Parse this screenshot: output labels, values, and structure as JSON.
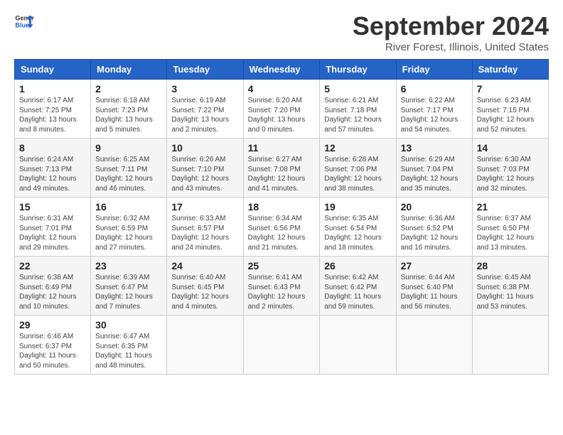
{
  "header": {
    "logo_line1": "General",
    "logo_line2": "Blue",
    "month": "September 2024",
    "location": "River Forest, Illinois, United States"
  },
  "days_of_week": [
    "Sunday",
    "Monday",
    "Tuesday",
    "Wednesday",
    "Thursday",
    "Friday",
    "Saturday"
  ],
  "weeks": [
    [
      {
        "day": "1",
        "info": "Sunrise: 6:17 AM\nSunset: 7:25 PM\nDaylight: 13 hours\nand 8 minutes."
      },
      {
        "day": "2",
        "info": "Sunrise: 6:18 AM\nSunset: 7:23 PM\nDaylight: 13 hours\nand 5 minutes."
      },
      {
        "day": "3",
        "info": "Sunrise: 6:19 AM\nSunset: 7:22 PM\nDaylight: 13 hours\nand 2 minutes."
      },
      {
        "day": "4",
        "info": "Sunrise: 6:20 AM\nSunset: 7:20 PM\nDaylight: 13 hours\nand 0 minutes."
      },
      {
        "day": "5",
        "info": "Sunrise: 6:21 AM\nSunset: 7:18 PM\nDaylight: 12 hours\nand 57 minutes."
      },
      {
        "day": "6",
        "info": "Sunrise: 6:22 AM\nSunset: 7:17 PM\nDaylight: 12 hours\nand 54 minutes."
      },
      {
        "day": "7",
        "info": "Sunrise: 6:23 AM\nSunset: 7:15 PM\nDaylight: 12 hours\nand 52 minutes."
      }
    ],
    [
      {
        "day": "8",
        "info": "Sunrise: 6:24 AM\nSunset: 7:13 PM\nDaylight: 12 hours\nand 49 minutes."
      },
      {
        "day": "9",
        "info": "Sunrise: 6:25 AM\nSunset: 7:11 PM\nDaylight: 12 hours\nand 46 minutes."
      },
      {
        "day": "10",
        "info": "Sunrise: 6:26 AM\nSunset: 7:10 PM\nDaylight: 12 hours\nand 43 minutes."
      },
      {
        "day": "11",
        "info": "Sunrise: 6:27 AM\nSunset: 7:08 PM\nDaylight: 12 hours\nand 41 minutes."
      },
      {
        "day": "12",
        "info": "Sunrise: 6:28 AM\nSunset: 7:06 PM\nDaylight: 12 hours\nand 38 minutes."
      },
      {
        "day": "13",
        "info": "Sunrise: 6:29 AM\nSunset: 7:04 PM\nDaylight: 12 hours\nand 35 minutes."
      },
      {
        "day": "14",
        "info": "Sunrise: 6:30 AM\nSunset: 7:03 PM\nDaylight: 12 hours\nand 32 minutes."
      }
    ],
    [
      {
        "day": "15",
        "info": "Sunrise: 6:31 AM\nSunset: 7:01 PM\nDaylight: 12 hours\nand 29 minutes."
      },
      {
        "day": "16",
        "info": "Sunrise: 6:32 AM\nSunset: 6:59 PM\nDaylight: 12 hours\nand 27 minutes."
      },
      {
        "day": "17",
        "info": "Sunrise: 6:33 AM\nSunset: 6:57 PM\nDaylight: 12 hours\nand 24 minutes."
      },
      {
        "day": "18",
        "info": "Sunrise: 6:34 AM\nSunset: 6:56 PM\nDaylight: 12 hours\nand 21 minutes."
      },
      {
        "day": "19",
        "info": "Sunrise: 6:35 AM\nSunset: 6:54 PM\nDaylight: 12 hours\nand 18 minutes."
      },
      {
        "day": "20",
        "info": "Sunrise: 6:36 AM\nSunset: 6:52 PM\nDaylight: 12 hours\nand 16 minutes."
      },
      {
        "day": "21",
        "info": "Sunrise: 6:37 AM\nSunset: 6:50 PM\nDaylight: 12 hours\nand 13 minutes."
      }
    ],
    [
      {
        "day": "22",
        "info": "Sunrise: 6:38 AM\nSunset: 6:49 PM\nDaylight: 12 hours\nand 10 minutes."
      },
      {
        "day": "23",
        "info": "Sunrise: 6:39 AM\nSunset: 6:47 PM\nDaylight: 12 hours\nand 7 minutes."
      },
      {
        "day": "24",
        "info": "Sunrise: 6:40 AM\nSunset: 6:45 PM\nDaylight: 12 hours\nand 4 minutes."
      },
      {
        "day": "25",
        "info": "Sunrise: 6:41 AM\nSunset: 6:43 PM\nDaylight: 12 hours\nand 2 minutes."
      },
      {
        "day": "26",
        "info": "Sunrise: 6:42 AM\nSunset: 6:42 PM\nDaylight: 11 hours\nand 59 minutes."
      },
      {
        "day": "27",
        "info": "Sunrise: 6:44 AM\nSunset: 6:40 PM\nDaylight: 11 hours\nand 56 minutes."
      },
      {
        "day": "28",
        "info": "Sunrise: 6:45 AM\nSunset: 6:38 PM\nDaylight: 11 hours\nand 53 minutes."
      }
    ],
    [
      {
        "day": "29",
        "info": "Sunrise: 6:46 AM\nSunset: 6:37 PM\nDaylight: 11 hours\nand 50 minutes."
      },
      {
        "day": "30",
        "info": "Sunrise: 6:47 AM\nSunset: 6:35 PM\nDaylight: 11 hours\nand 48 minutes."
      },
      {
        "day": "",
        "info": ""
      },
      {
        "day": "",
        "info": ""
      },
      {
        "day": "",
        "info": ""
      },
      {
        "day": "",
        "info": ""
      },
      {
        "day": "",
        "info": ""
      }
    ]
  ]
}
